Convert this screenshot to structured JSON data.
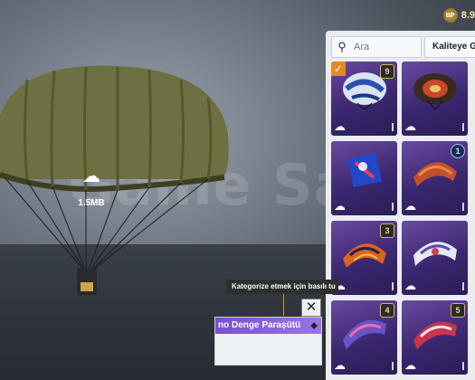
{
  "currency": {
    "icon": "bp-coin-icon",
    "coin_text": "BP",
    "amount": "8.9"
  },
  "preview": {
    "download_size": "1.5MB",
    "watermark": "Game Satis"
  },
  "search": {
    "placeholder": "Ara"
  },
  "sort": {
    "label": "Kaliteye Gö"
  },
  "tooltip": {
    "text": "Kategorize etmek için basılı tu"
  },
  "item_card": {
    "name": "no Denge Paraşütü"
  },
  "grid_items": [
    {
      "level": "9",
      "selected": true
    },
    {
      "level": ""
    },
    {
      "level": ""
    },
    {
      "level": "1"
    },
    {
      "level": "3"
    },
    {
      "level": ""
    },
    {
      "level": "4"
    },
    {
      "level": "5"
    }
  ],
  "colors": {
    "accent_orange": "#e58a1f",
    "tile_purple": "#4b3285",
    "card_name_purple": "#7a4fd0"
  }
}
